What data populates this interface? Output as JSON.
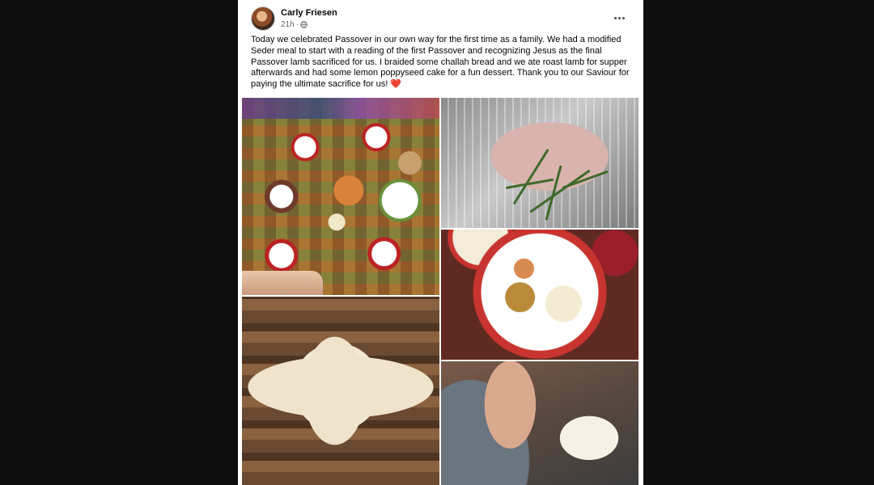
{
  "post": {
    "author": "Carly Friesen",
    "time": "21h",
    "separator": "·",
    "privacy_icon": "globe-icon",
    "menu_icon": "more-dots-icon",
    "text": "Today we celebrated Passover in our own way for the first time as a family. We had a modified Seder meal to start with a reading of the first Passover and recognizing Jesus as the final Passover lamb sacrificed for us. I braided some challah bread and we ate roast lamb for supper afterwards and had some lemon poppyseed cake for a fun dessert. Thank you to our Saviour for paying the ultimate sacrifice for us!",
    "emoji": "❤️"
  },
  "colors": {
    "page_background": "#0e0e0e",
    "card_background": "#ffffff",
    "text_primary": "#050505",
    "text_secondary": "#65676b"
  },
  "photos": [
    {
      "subject": "table-spread-photo"
    },
    {
      "subject": "lamb-with-rosemary-photo"
    },
    {
      "subject": "seder-plate-photo"
    },
    {
      "subject": "braided-challah-photo"
    },
    {
      "subject": "man-reading-bible-photo"
    }
  ]
}
